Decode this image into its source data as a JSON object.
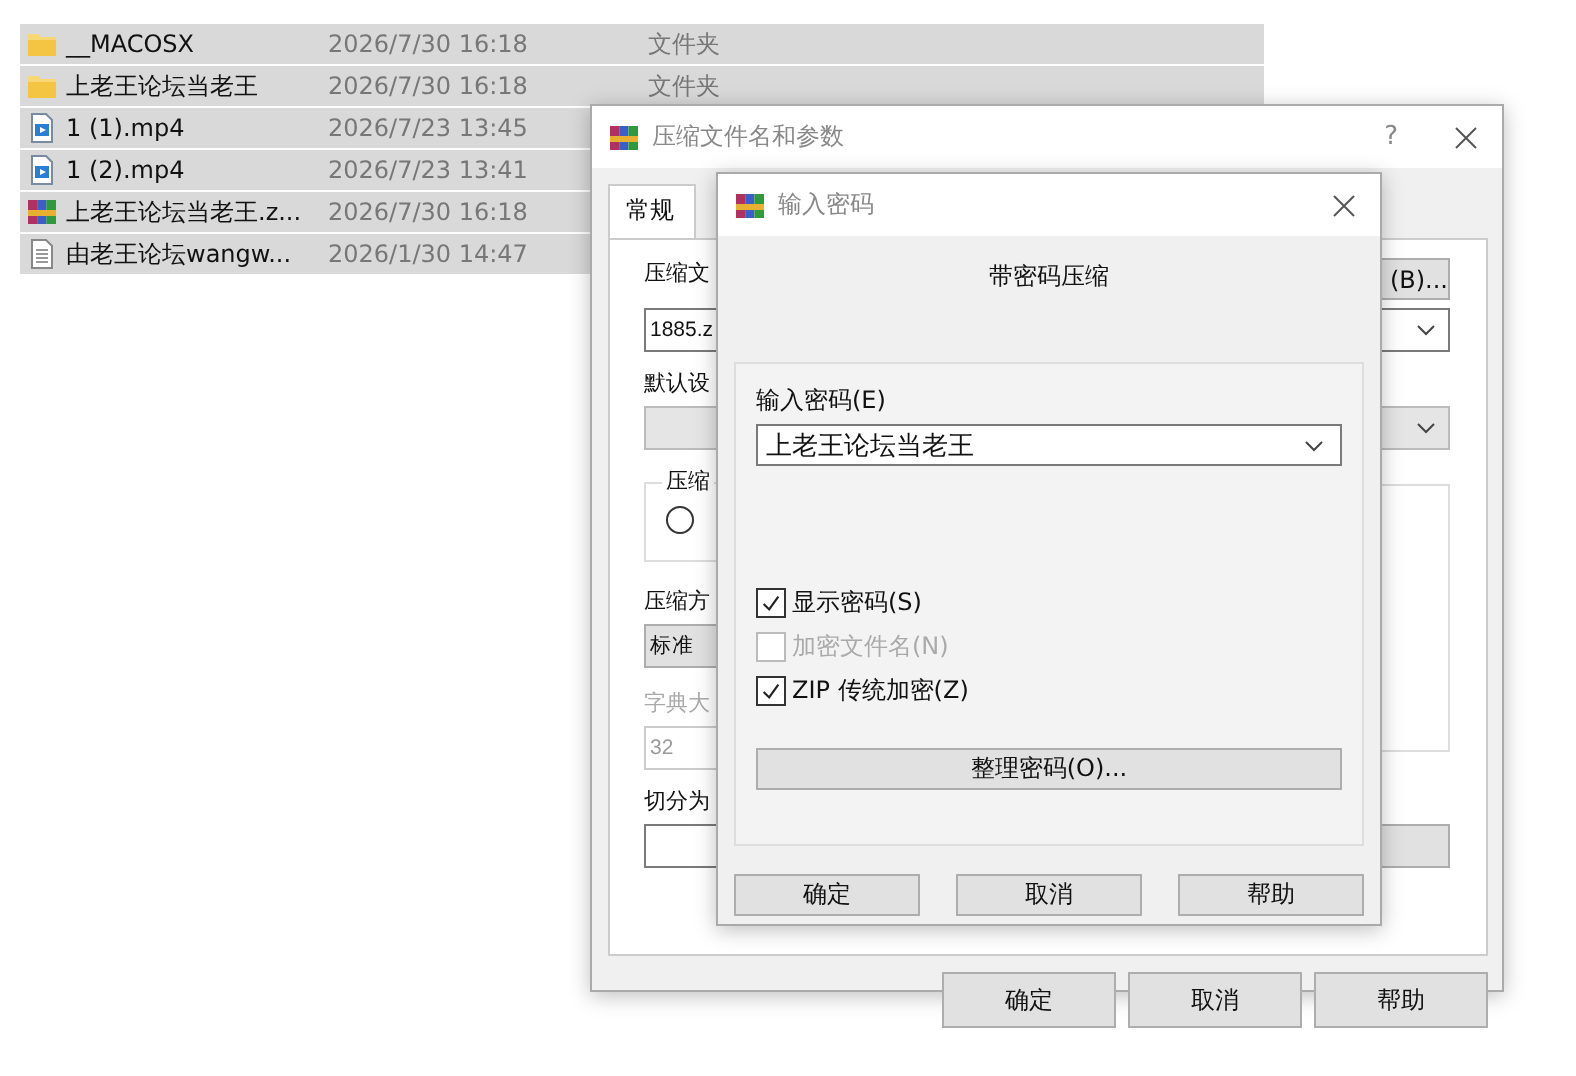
{
  "file_list": {
    "rows": [
      {
        "kind": "folder",
        "name": "__MACOSX",
        "modified": "2026/7/30 16:18",
        "type": "文件夹",
        "selected": true
      },
      {
        "kind": "folder",
        "name": "上老王论坛当老王",
        "modified": "2026/7/30 16:18",
        "type": "文件夹",
        "selected": true
      },
      {
        "kind": "video",
        "name": "1 (1).mp4",
        "modified": "2026/7/23 13:45",
        "selected": true
      },
      {
        "kind": "video",
        "name": "1 (2).mp4",
        "modified": "2026/7/23 13:41",
        "selected": true
      },
      {
        "kind": "archive",
        "name": "上老王论坛当老王.z...",
        "modified": "2026/7/30 16:18",
        "selected": true
      },
      {
        "kind": "text",
        "name": "由老王论坛wangw...",
        "modified": "2026/1/30 14:47",
        "selected": true
      }
    ]
  },
  "archive_dialog": {
    "title": "压缩文件名和参数",
    "help": "?",
    "tabs": [
      {
        "label": "常规",
        "selected": true
      }
    ],
    "archive_name_label": "压缩文",
    "browse_button": "(B)...",
    "archive_name": "1885.z",
    "profile_label": "默认设",
    "format_group_label": "压缩",
    "format_option": {
      "checked": false
    },
    "method_label": "压缩方",
    "method_value": "标准",
    "dictionary": {
      "label": "字典大",
      "value": "32",
      "disabled": true
    },
    "split_label": "切分为",
    "buttons": [
      "确定",
      "取消",
      "帮助"
    ]
  },
  "password_dialog": {
    "title": "输入密码",
    "heading": "带密码压缩",
    "password_label": "输入密码(E)",
    "password": "上老王论坛当老王",
    "options": [
      {
        "label": "显示密码(S)",
        "checked": true,
        "disabled": false
      },
      {
        "label": "加密文件名(N)",
        "checked": false,
        "disabled": true
      },
      {
        "label": "ZIP 传统加密(Z)",
        "checked": true,
        "disabled": false
      }
    ],
    "organize_button": "整理密码(O)...",
    "buttons": [
      "确定",
      "取消",
      "帮助"
    ]
  }
}
